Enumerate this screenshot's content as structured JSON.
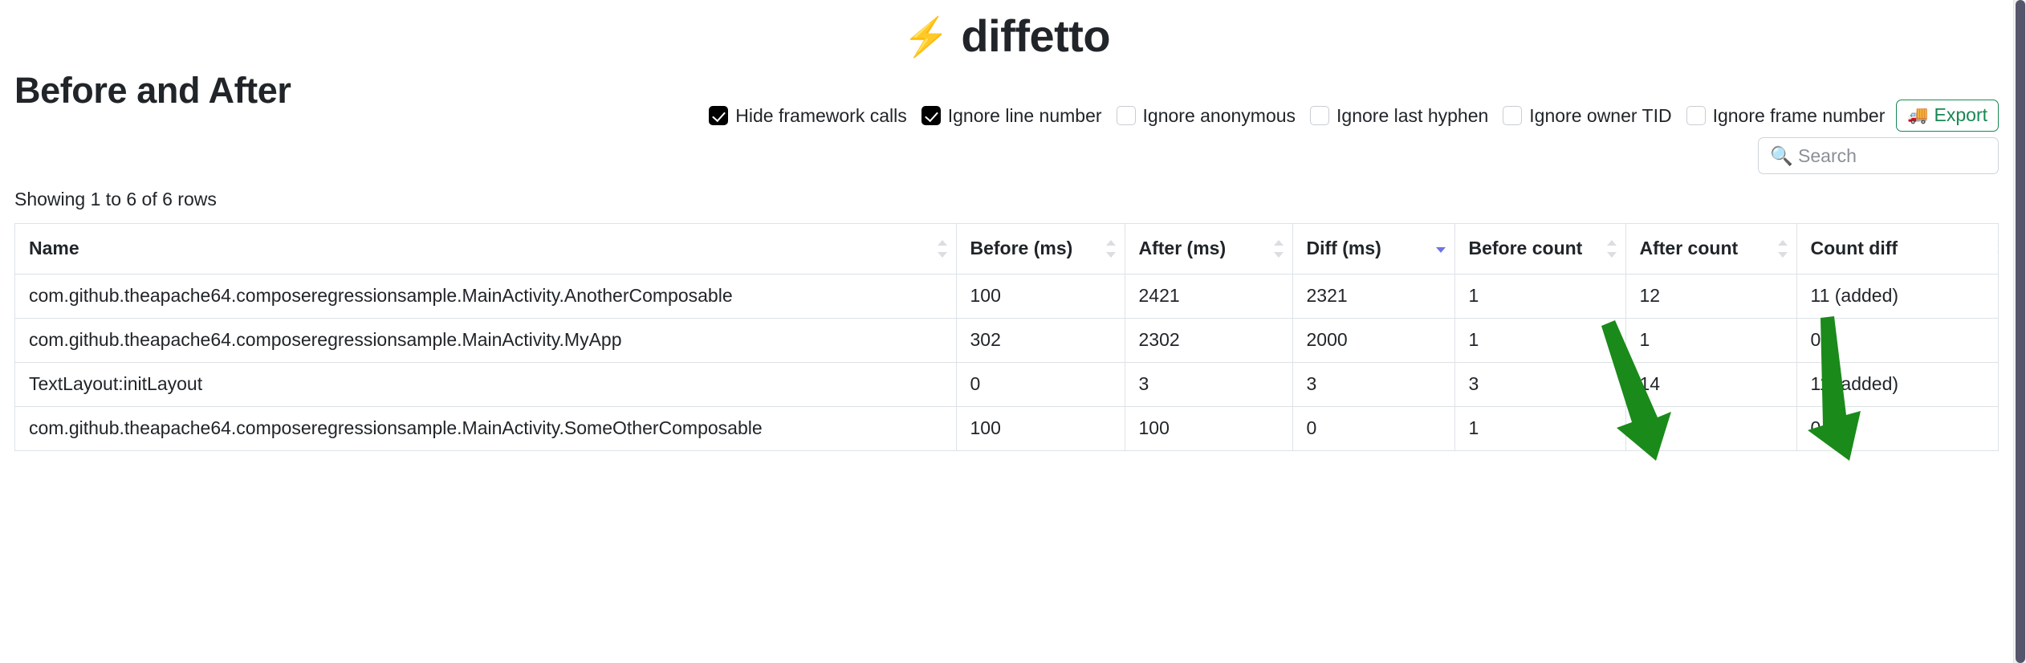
{
  "brand": {
    "bolt_icon": "⚡",
    "name": "diffetto"
  },
  "page_title": "Before and After",
  "options": [
    {
      "label": "Hide framework calls",
      "checked": true
    },
    {
      "label": "Ignore line number",
      "checked": true
    },
    {
      "label": "Ignore anonymous",
      "checked": false
    },
    {
      "label": "Ignore last hyphen",
      "checked": false
    },
    {
      "label": "Ignore owner TID",
      "checked": false
    },
    {
      "label": "Ignore frame number",
      "checked": false
    }
  ],
  "export": {
    "label": "Export",
    "icon": "🚚",
    "color": "#198754"
  },
  "search": {
    "placeholder": "🔍 Search",
    "value": ""
  },
  "showing": "Showing 1 to 6 of 6 rows",
  "table": {
    "columns": [
      {
        "label": "Name",
        "sort": "none"
      },
      {
        "label": "Before (ms)",
        "sort": "none"
      },
      {
        "label": "After (ms)",
        "sort": "none"
      },
      {
        "label": "Diff (ms)",
        "sort": "desc"
      },
      {
        "label": "Before count",
        "sort": "none"
      },
      {
        "label": "After count",
        "sort": "none"
      },
      {
        "label": "Count diff",
        "sort": "none"
      }
    ],
    "rows": [
      {
        "name": "com.github.theapache64.composeregressionsample.MainActivity.AnotherComposable",
        "before_ms": "100",
        "after_ms": "2421",
        "diff_ms": "2321",
        "before_count": "1",
        "after_count": "12",
        "count_diff": "11 (added)"
      },
      {
        "name": "com.github.theapache64.composeregressionsample.MainActivity.MyApp",
        "before_ms": "302",
        "after_ms": "2302",
        "diff_ms": "2000",
        "before_count": "1",
        "after_count": "1",
        "count_diff": "0"
      },
      {
        "name": "TextLayout:initLayout",
        "before_ms": "0",
        "after_ms": "3",
        "diff_ms": "3",
        "before_count": "3",
        "after_count": "14",
        "count_diff": "11 (added)"
      },
      {
        "name": "com.github.theapache64.composeregressionsample.MainActivity.SomeOtherComposable",
        "before_ms": "100",
        "after_ms": "100",
        "diff_ms": "0",
        "before_count": "1",
        "after_count": "1",
        "count_diff": "0"
      }
    ]
  },
  "annotations": {
    "arrow_color": "#1a8a1a",
    "arrows": [
      {
        "target": "after-count-first-cell"
      },
      {
        "target": "count-diff-first-cell"
      }
    ]
  }
}
